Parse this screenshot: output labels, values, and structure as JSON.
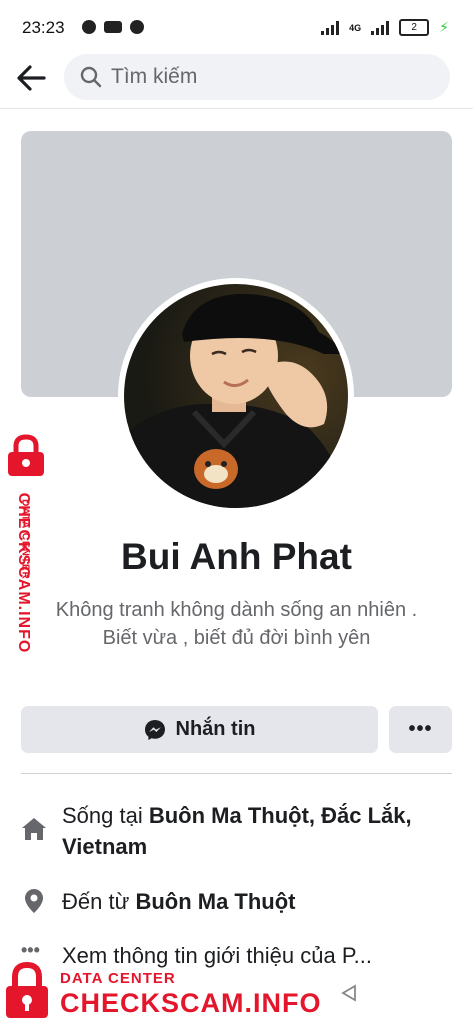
{
  "status_bar": {
    "time": "23:23",
    "network_label": "4G",
    "battery_level": "2"
  },
  "header": {
    "search_placeholder": "Tìm kiếm"
  },
  "profile": {
    "name": "Bui Anh Phat",
    "bio": "Không tranh không dành sống an nhiên . Biết vừa , biết đủ đời bình yên"
  },
  "actions": {
    "message_label": "Nhắn tin",
    "more_label": "•••"
  },
  "intro": {
    "lives_prefix": "Sống tại ",
    "lives_value": "Buôn Ma Thuột, Đắc Lắk, Vietnam",
    "from_prefix": "Đến từ ",
    "from_value": "Buôn Ma Thuột",
    "see_more": "Xem thông tin giới thiệu của P..."
  },
  "watermark": {
    "small": "DATA CENTER",
    "big": "CHECKSCAM.INFO"
  },
  "colors": {
    "accent": "#e3162b",
    "button_bg": "#e4e6eb",
    "cover_bg": "#ccd0d5"
  }
}
